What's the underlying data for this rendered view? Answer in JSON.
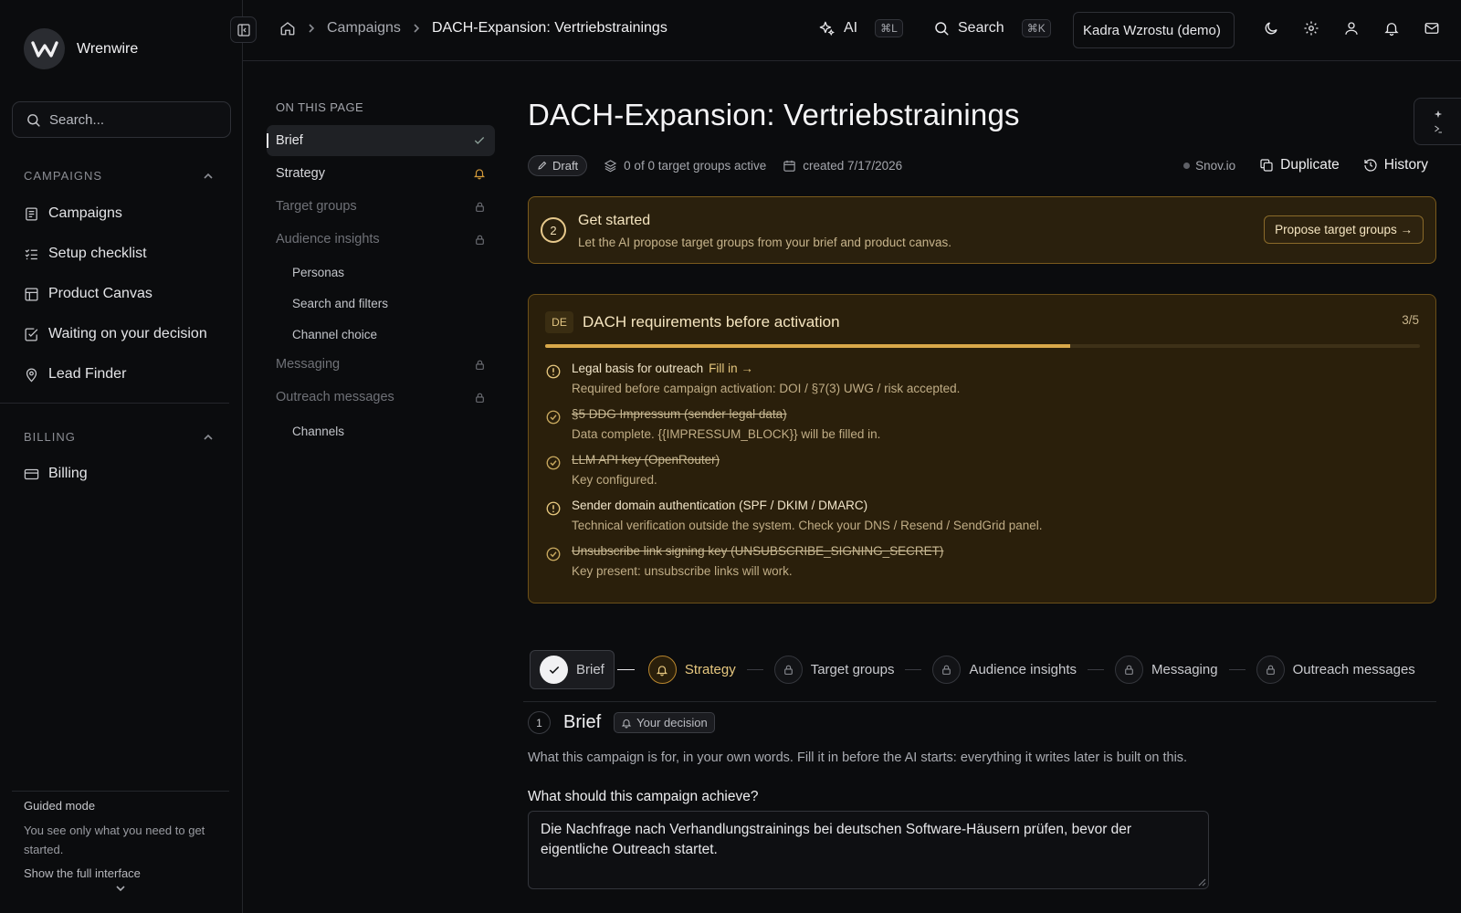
{
  "app": {
    "name": "Wrenwire"
  },
  "sidebar": {
    "search_placeholder": "Search...",
    "sections": [
      {
        "title": "CAMPAIGNS",
        "items": [
          "Campaigns",
          "Setup checklist",
          "Product Canvas",
          "Waiting on your decision",
          "Lead Finder"
        ]
      },
      {
        "title": "BILLING",
        "items": [
          "Billing"
        ]
      }
    ],
    "guided": {
      "title": "Guided mode",
      "text": "You see only what you need to get started.",
      "link": "Show the full interface"
    }
  },
  "topbar": {
    "breadcrumb": [
      "Campaigns",
      "DACH-Expansion: Vertriebstrainings"
    ],
    "ai_label": "AI",
    "ai_shortcut": "⌘L",
    "search_label": "Search",
    "search_shortcut": "⌘K",
    "workspace": "Kadra Wzrostu (demo)"
  },
  "toc": {
    "title": "ON THIS PAGE",
    "items": [
      {
        "label": "Brief",
        "state": "done"
      },
      {
        "label": "Strategy",
        "state": "warning"
      },
      {
        "label": "Target groups",
        "state": "locked"
      },
      {
        "label": "Audience insights",
        "state": "locked"
      },
      {
        "label": "Personas",
        "state": "sub"
      },
      {
        "label": "Search and filters",
        "state": "sub"
      },
      {
        "label": "Channel choice",
        "state": "sub"
      },
      {
        "label": "Messaging",
        "state": "locked"
      },
      {
        "label": "Outreach messages",
        "state": "locked"
      },
      {
        "label": "Channels",
        "state": "sub"
      }
    ]
  },
  "page": {
    "title": "DACH-Expansion: Vertriebstrainings",
    "status": "Draft",
    "target_groups": "0 of 0 target groups active",
    "created": "created 7/17/2026",
    "provider": "Snov.io",
    "duplicate_label": "Duplicate",
    "history_label": "History"
  },
  "get_started": {
    "step": "2",
    "title": "Get started",
    "subtitle": "Let the AI propose target groups from your brief and product canvas.",
    "button": "Propose target groups →"
  },
  "dach": {
    "badge": "DE",
    "title": "DACH requirements before activation",
    "count": "3/5",
    "progress": 0.6,
    "items": [
      {
        "title": "Legal basis for outreach",
        "link": "Fill in →",
        "subtitle": "Required before campaign activation: DOI / §7(3) UWG / risk accepted.",
        "done": false
      },
      {
        "title": "§5 DDG Impressum (sender legal data)",
        "link": "",
        "subtitle": "Data complete. {{IMPRESSUM_BLOCK}} will be filled in.",
        "done": true
      },
      {
        "title": "LLM API key (OpenRouter)",
        "link": "",
        "subtitle": "Key configured.",
        "done": true
      },
      {
        "title": "Sender domain authentication (SPF / DKIM / DMARC)",
        "link": "",
        "subtitle": "Technical verification outside the system. Check your DNS / Resend / SendGrid panel.",
        "done": false
      },
      {
        "title": "Unsubscribe link signing key (UNSUBSCRIBE_SIGNING_SECRET)",
        "link": "",
        "subtitle": "Key present: unsubscribe links will work.",
        "done": true
      }
    ]
  },
  "stepper": [
    "Brief",
    "Strategy",
    "Target groups",
    "Audience insights",
    "Messaging",
    "Outreach messages"
  ],
  "brief": {
    "number": "1",
    "title": "Brief",
    "badge": "Your decision",
    "description": "What this campaign is for, in your own words. Fill it in before the AI starts: everything it writes later is built on this.",
    "field_label": "What should this campaign achieve?",
    "field_value": "Die Nachfrage nach Verhandlungstrainings bei deutschen Software-Häusern prüfen, bevor der eigentliche Outreach startet."
  },
  "colors": {
    "accent": "#d9a84a",
    "warning_bg": "#2a200d",
    "background": "#0b0c0e"
  }
}
